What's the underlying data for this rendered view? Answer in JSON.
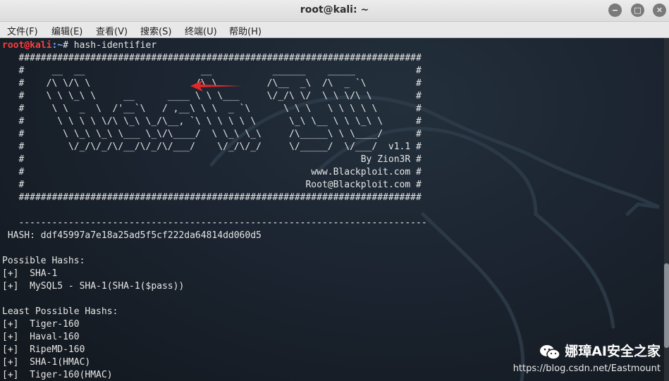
{
  "window": {
    "title": "root@kali: ~",
    "buttons": {
      "minimize": "−",
      "maximize": "□",
      "close": "✕"
    }
  },
  "menu": [
    "文件(F)",
    "编辑(E)",
    "查看(V)",
    "搜索(S)",
    "终端(U)",
    "帮助(H)"
  ],
  "terminal": {
    "prompt_user": "root@kali",
    "prompt_path": ":~",
    "prompt_symbol": "# ",
    "command": "hash-identifier",
    "output": "   #########################################################################\n   #     __  __                     __           ______    _____           #\n   #    /\\ \\/\\ \\                   /\\ \\         /\\__  _\\  /\\  _ `\\         #\n   #    \\ \\ \\_\\ \\     __      ____ \\ \\ \\___     \\/_/\\ \\/  \\ \\ \\/\\ \\        #\n   #     \\ \\  _  \\  /'__`\\   / ,__\\ \\ \\  _ `\\      \\ \\ \\   \\ \\ \\ \\ \\       #\n   #      \\ \\ \\ \\ \\/\\ \\_\\ \\_/\\__, `\\ \\ \\ \\ \\ \\      \\_\\ \\__ \\ \\ \\_\\ \\      #\n   #       \\ \\_\\ \\_\\ \\___ \\_\\/\\____/  \\ \\_\\ \\_\\     /\\_____\\ \\ \\____/      #\n   #        \\/_/\\/_/\\/__/\\/_/\\/___/    \\/_/\\/_/     \\/_____/  \\/___/  v1.1 #\n   #                                                             By Zion3R #\n   #                                                    www.Blackploit.com #\n   #                                                   Root@Blackploit.com #\n   #########################################################################\n\n   --------------------------------------------------------------------------\n HASH: ddf45997a7e18a25ad5f5cf222da64814dd060d5\n\nPossible Hashs:\n[+]  SHA-1\n[+]  MySQL5 - SHA-1(SHA-1($pass))\n\nLeast Possible Hashs:\n[+]  Tiger-160\n[+]  Haval-160\n[+]  RipeMD-160\n[+]  SHA-1(HMAC)\n[+]  Tiger-160(HMAC)"
  },
  "watermark": {
    "title": "娜璋AI安全之家",
    "url": "https://blog.csdn.net/Eastmount"
  },
  "colors": {
    "prompt_user": "#ff3c3c",
    "prompt_path": "#7fa8ff",
    "annotation_arrow": "#e02828"
  }
}
